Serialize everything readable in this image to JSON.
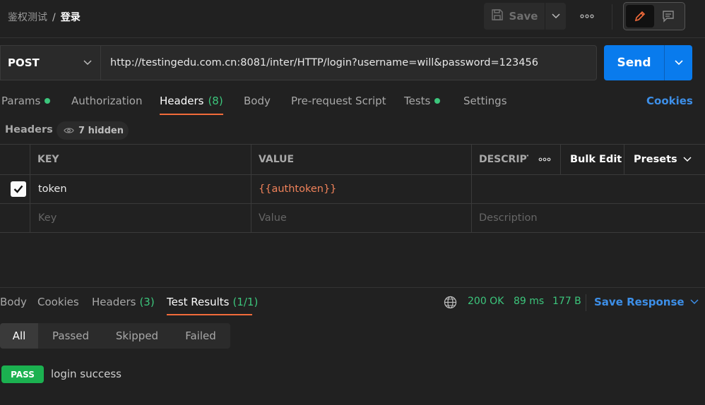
{
  "breadcrumb": {
    "parent": "鉴权测试",
    "separator": "/",
    "current": "登录"
  },
  "toolbar": {
    "save_label": "Save"
  },
  "request": {
    "method": "POST",
    "url": "http://testingedu.com.cn:8081/inter/HTTP/login?username=will&password=123456",
    "send_label": "Send"
  },
  "tabs": [
    {
      "label": "Params"
    },
    {
      "label": "Authorization"
    },
    {
      "label": "Headers",
      "count": "(8)"
    },
    {
      "label": "Body"
    },
    {
      "label": "Pre-request Script"
    },
    {
      "label": "Tests"
    },
    {
      "label": "Settings"
    }
  ],
  "cookies_label": "Cookies",
  "headers_section": {
    "title": "Headers",
    "hidden_label": "7 hidden"
  },
  "table": {
    "columns": {
      "key": "KEY",
      "value": "VALUE",
      "description": "DESCRIPTION"
    },
    "bulk_edit": "Bulk Edit",
    "presets": "Presets",
    "rows": [
      {
        "key": "token",
        "value": "{{authtoken}}",
        "description": ""
      }
    ],
    "placeholders": {
      "key": "Key",
      "value": "Value",
      "description": "Description"
    }
  },
  "response": {
    "tabs": [
      {
        "label": "Body"
      },
      {
        "label": "Cookies"
      },
      {
        "label": "Headers",
        "count": "(3)"
      },
      {
        "label": "Test Results",
        "count": "(1/1)"
      }
    ],
    "status": "200 OK",
    "time": "89 ms",
    "size": "177 B",
    "save_response": "Save Response",
    "filters": [
      "All",
      "Passed",
      "Skipped",
      "Failed"
    ],
    "results": [
      {
        "badge": "PASS",
        "name": "login success"
      }
    ]
  },
  "colors": {
    "accent_orange": "#f26b3a",
    "send_blue": "#097bed",
    "success_green": "#3cc67c",
    "link_blue": "#3d8fe8",
    "pass_green": "#1bb150"
  }
}
